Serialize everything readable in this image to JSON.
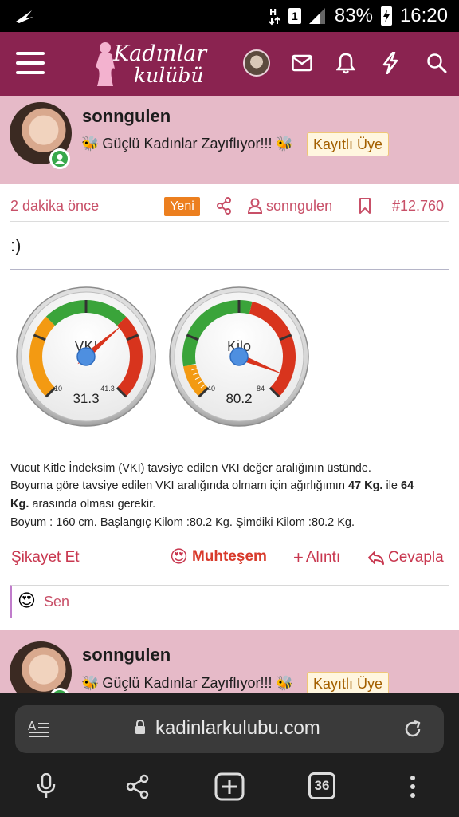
{
  "status_bar": {
    "sim_slot": "1",
    "battery": "83%",
    "time": "16:20"
  },
  "site": {
    "logo_line1": "Kadınlar",
    "logo_line2": "kulübü"
  },
  "post": {
    "username": "sonngulen",
    "user_title": "Güçlü Kadınlar Zayıflıyor!!!",
    "badge": "Kayıtlı Üye",
    "time_ago": "2 dakika önce",
    "new_label": "Yeni",
    "author_link": "sonngulen",
    "post_number": "#12.760",
    "body_short": ":)",
    "gauges": [
      {
        "label": "VKI",
        "value_text": "31.3",
        "min_label": "10",
        "max_label": "41.3",
        "value": 31.3,
        "min": 10,
        "max": 41.3
      },
      {
        "label": "Kilo",
        "value_text": "80.2",
        "min_label": "40",
        "max_label": "84",
        "value": 80.2,
        "min": 40,
        "max": 84
      }
    ],
    "info": {
      "line1": "Vücut Kitle İndeksim (VKI) tavsiye edilen VKI değer aralığının üstünde.",
      "line2_pre": "Boyuma göre tavsiye edilen VKI aralığında olmam için ağırlığımın ",
      "weight_min": "47 Kg.",
      "line2_mid": " ile ",
      "weight_max_part1": "64",
      "weight_max_part2": "Kg.",
      "line3_post": " arasında olması gerekir.",
      "line4": "Boyum : 160 cm. Başlangıç Kilom :80.2 Kg. Şimdiki Kilom :80.2 Kg."
    },
    "actions": {
      "report": "Şikayet Et",
      "reaction": "Muhteşem",
      "quote": "Alıntı",
      "reply": "Cevapla"
    },
    "reaction_summary": "Sen"
  },
  "next_post": {
    "username": "sonngulen",
    "user_title": "Güçlü Kadınlar Zayıflıyor!!!",
    "badge": "Kayıtlı Üye"
  },
  "browser": {
    "url": "kadinlarkulubu.com",
    "tab_count": "36"
  },
  "colors": {
    "nav": "#8a2350",
    "post_header": "#e6bac8",
    "accent_text": "#c85068",
    "new_badge": "#ec7f1f",
    "gauge_green": "#3aa43a",
    "gauge_orange": "#f39a12",
    "gauge_red": "#d8341d"
  }
}
